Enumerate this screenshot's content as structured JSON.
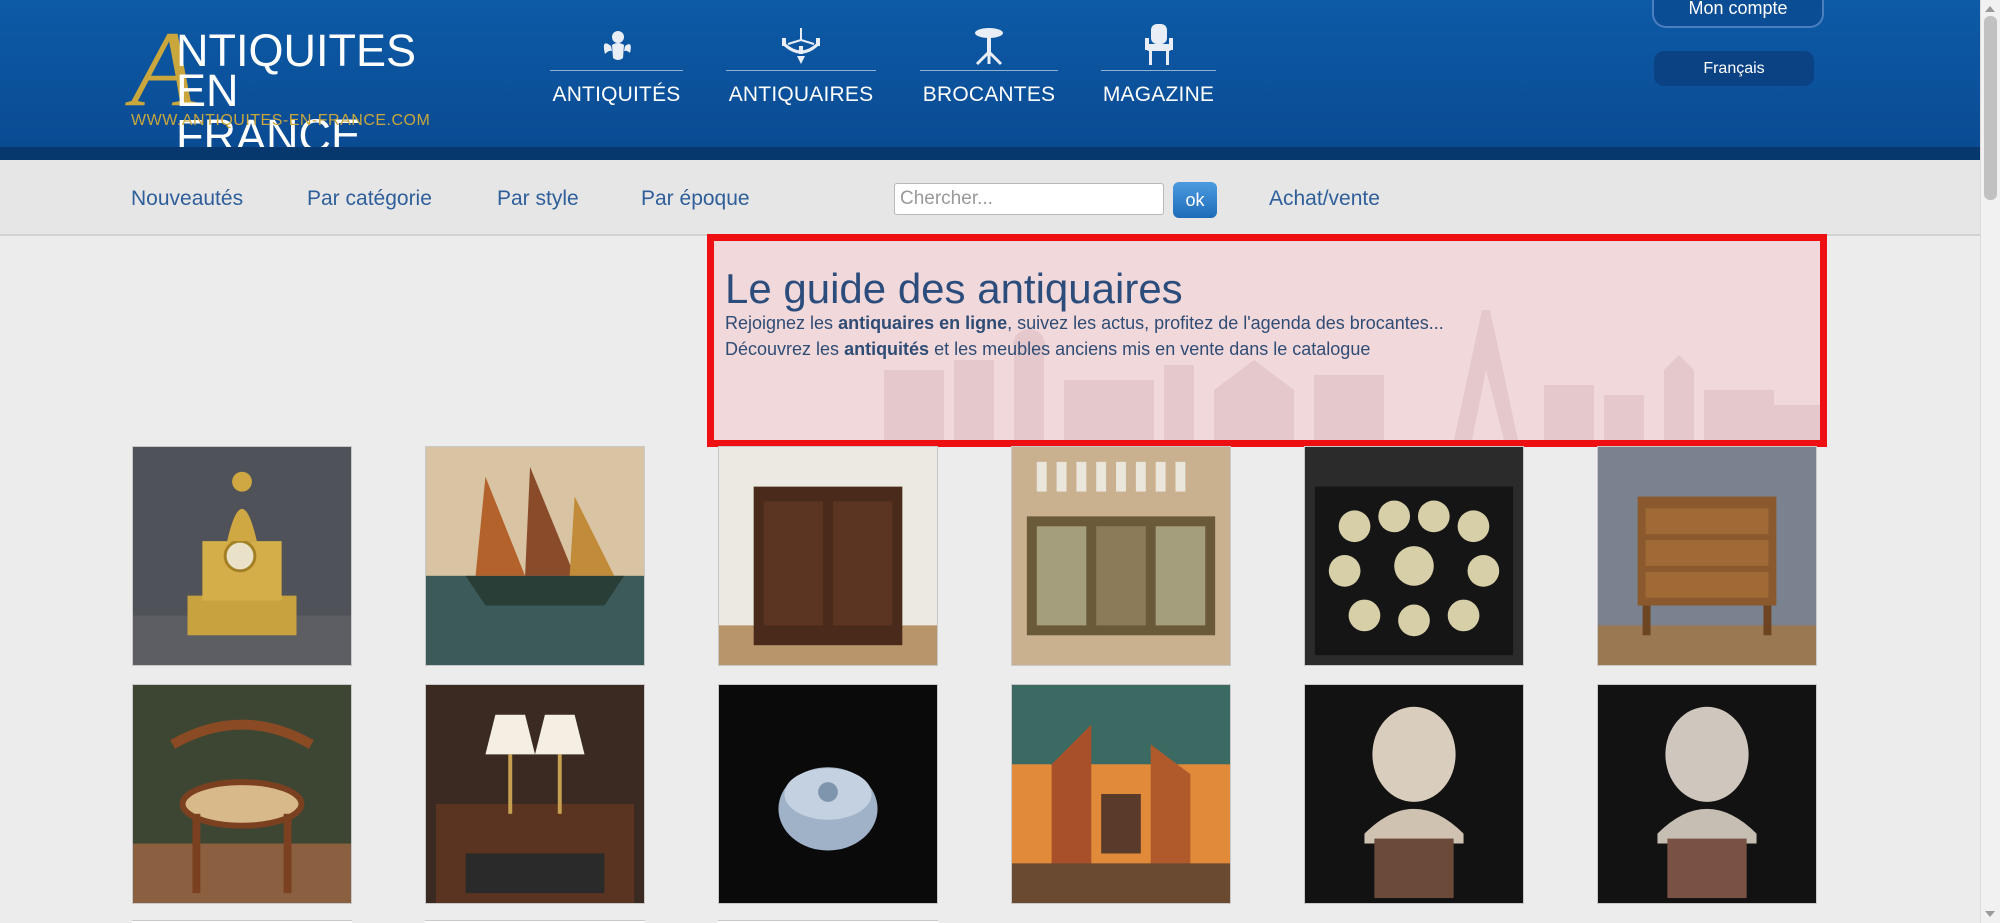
{
  "header": {
    "logo": {
      "big_letter": "A",
      "line1": "NTIQUITES",
      "line2": "EN FRANCE",
      "url": "WWW.ANTIQUITES-EN-FRANCE.COM"
    },
    "nav": [
      {
        "label": "ANTIQUITÉS",
        "icon": "cherub-icon"
      },
      {
        "label": "ANTIQUAIRES",
        "icon": "chandelier-icon"
      },
      {
        "label": "BROCANTES",
        "icon": "pedestal-table-icon"
      },
      {
        "label": "MAGAZINE",
        "icon": "armchair-icon"
      }
    ],
    "account_label": "Mon compte",
    "language_label": "Français"
  },
  "subnav": {
    "links": [
      "Nouveautés",
      "Par catégorie",
      "Par style",
      "Par époque"
    ],
    "search_placeholder": "Chercher...",
    "ok_label": "ok",
    "buy_sell_label": "Achat/vente"
  },
  "hero": {
    "title": "Le guide des antiquaires",
    "line1_pre": "Rejoignez les ",
    "line1_bold": "antiquaires en ligne",
    "line1_post": ", suivez les actus, profitez de l'agenda des brocantes...",
    "line2_pre": "Découvrez les ",
    "line2_bold": "antiquités",
    "line2_post": " et les meubles anciens mis en vente dans le catalogue"
  },
  "products": [
    {
      "name": "gilt-bronze-clock"
    },
    {
      "name": "sailboats-painting"
    },
    {
      "name": "walnut-corner-cabinet"
    },
    {
      "name": "glassware-sideboard"
    },
    {
      "name": "porcelain-tea-set"
    },
    {
      "name": "walnut-chest-of-drawers"
    },
    {
      "name": "bentwood-cane-armchair"
    },
    {
      "name": "writing-desk-with-lamps"
    },
    {
      "name": "glass-flower-box"
    },
    {
      "name": "ruined-church-painting"
    },
    {
      "name": "child-bust-sculpture-1"
    },
    {
      "name": "child-bust-sculpture-2"
    }
  ],
  "colors": {
    "header_blue": "#0b4d95",
    "link_blue": "#2f5f9a",
    "highlight_border": "#ee0f12",
    "logo_gold": "#c9a73c"
  }
}
